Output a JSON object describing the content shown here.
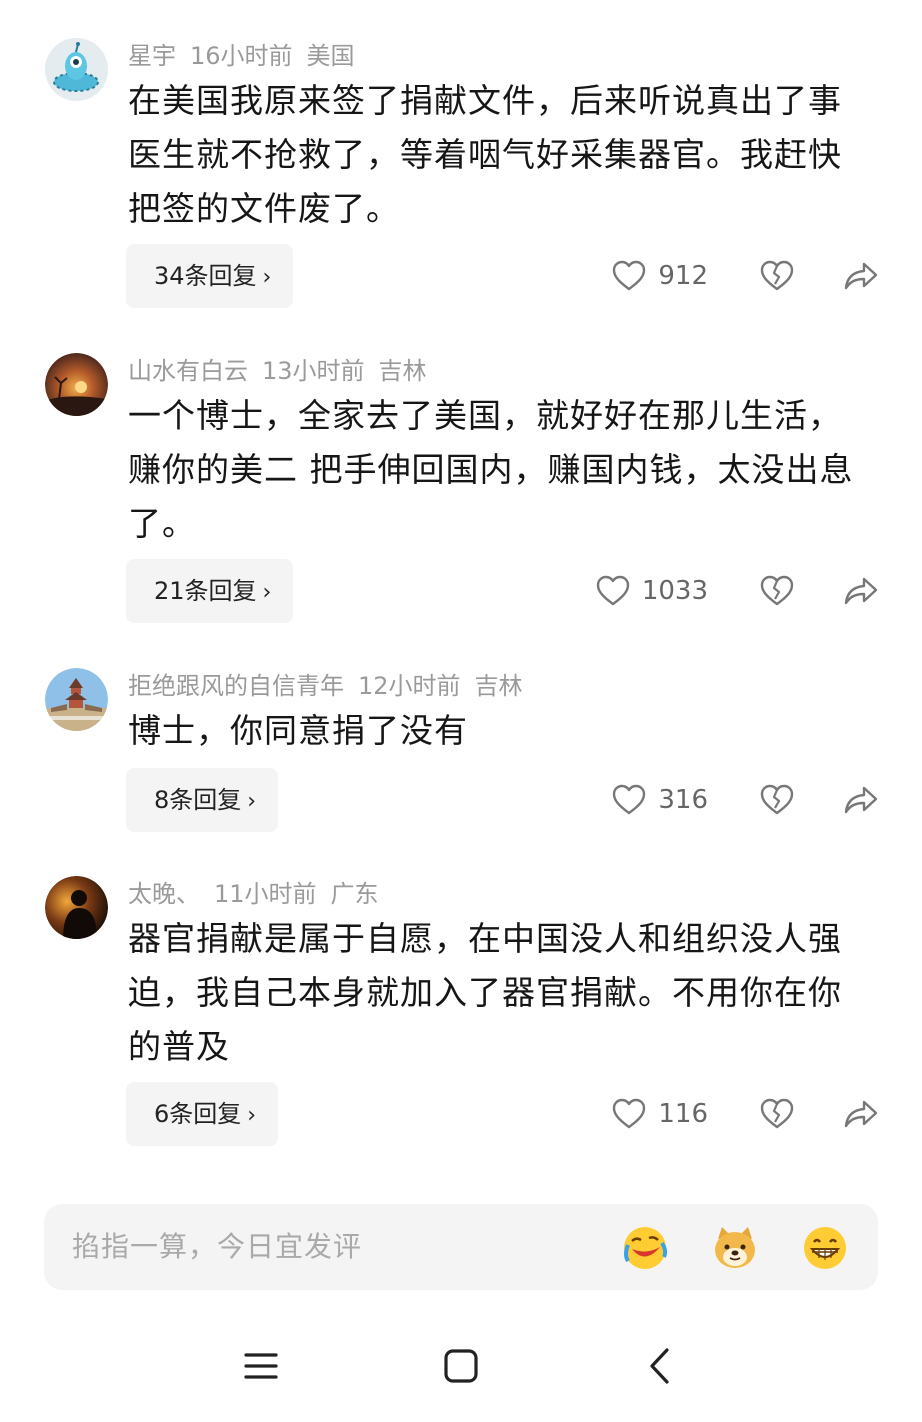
{
  "comments": [
    {
      "user": "星宇",
      "time": "16小时前",
      "location": "美国",
      "text": "在美国我原来签了捐献文件，后来听说真出了事医生就不抢救了，等着咽气好采集器官。我赶快把签的文件废了。",
      "replies": "34条回复",
      "likes": "912"
    },
    {
      "user": "山水有白云",
      "time": "13小时前",
      "location": "吉林",
      "text": "一个博士，全家去了美国，就好好在那儿生活，赚你的美二 把手伸回国内，赚国内钱，太没出息了。",
      "replies": "21条回复",
      "likes": "1033"
    },
    {
      "user": "拒绝跟风的自信青年",
      "time": "12小时前",
      "location": "吉林",
      "text": "博士，你同意捐了没有",
      "replies": "8条回复",
      "likes": "316"
    },
    {
      "user": "太晚、",
      "time": "11小时前",
      "location": "广东",
      "text": "器官捐献是属于自愿，在中国没人和组织没人强迫，我自己本身就加入了器官捐献。不用你在你的普及",
      "replies": "6条回复",
      "likes": "116"
    }
  ],
  "input": {
    "placeholder": "掐指一算，今日宜发评"
  },
  "icons": {
    "like": "heart-outline-icon",
    "dislike": "broken-heart-icon",
    "share": "share-arrow-icon",
    "reply_chevron": "chevron-right-icon",
    "emoji_1": "laughing-tears-emoji-icon",
    "emoji_2": "doge-emoji-icon",
    "emoji_3": "grinning-emoji-icon",
    "nav_menu": "menu-icon",
    "nav_home": "home-square-icon",
    "nav_back": "back-chevron-icon"
  },
  "colors": {
    "meta_text": "#9a9a9a",
    "body_text": "#161616",
    "reply_bg": "#f4f4f4",
    "icon_gray": "#777777"
  }
}
